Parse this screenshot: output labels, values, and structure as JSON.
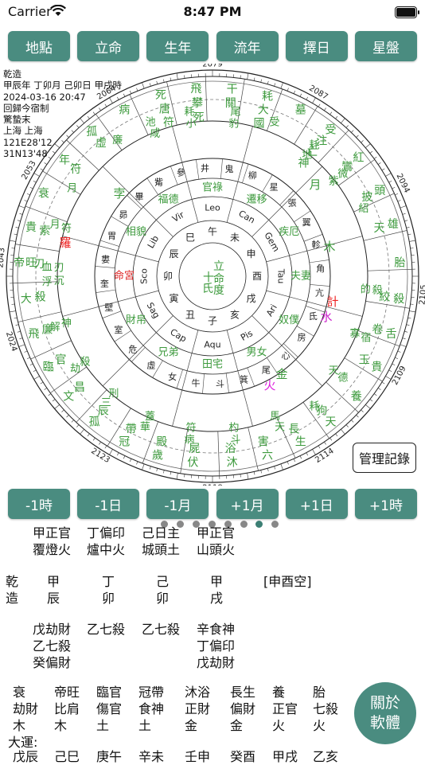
{
  "status_bar": {
    "carrier": "Carrier",
    "time": "8:47 PM"
  },
  "top_buttons": [
    "地點",
    "立命",
    "生年",
    "流年",
    "擇日",
    "星盤"
  ],
  "bottom_buttons": [
    "-1時",
    "-1日",
    "-1月",
    "+1月",
    "+1日",
    "+1時"
  ],
  "records_button": "管理記錄",
  "about_button": [
    "關於",
    "軟體"
  ],
  "chart_info": [
    "乾造",
    "甲辰年 丁卯月 己卯日 甲戌時",
    "2024-03-16 20:47",
    "回歸今宿制",
    "驚蟄末",
    "上海 上海",
    "121E28'12",
    " 31N13'48"
  ],
  "wheel": {
    "year_ticks": [
      "2079",
      "2087",
      "2094",
      "2105",
      "2109",
      "2114",
      "2118",
      "2123",
      "2024",
      "2043",
      "2053",
      "2064"
    ],
    "outer_spokes": [
      {
        "a": -86,
        "words": [
          "帝旺",
          "刃"
        ]
      },
      {
        "a": -75,
        "words": [
          "貴",
          "索"
        ]
      },
      {
        "a": -64,
        "words": [
          "衰"
        ]
      },
      {
        "a": -52,
        "words": [
          "年",
          "符"
        ]
      },
      {
        "a": -40,
        "words": [
          "孤",
          "虛"
        ]
      },
      {
        "a": -28,
        "words": [
          "病"
        ]
      },
      {
        "a": -16,
        "words": [
          "死",
          "唐",
          "符"
        ]
      },
      {
        "a": -5,
        "words": [
          "飛",
          "攀",
          "死"
        ]
      },
      {
        "a": 6,
        "words": [
          "干",
          "關"
        ]
      },
      {
        "a": 17,
        "words": [
          "耗",
          "大",
          "國"
        ]
      },
      {
        "a": 28,
        "words": [
          "墓"
        ]
      },
      {
        "a": 39,
        "words": [
          "受",
          "注",
          "亡",
          "神"
        ]
      },
      {
        "a": 51,
        "words": [
          "紅",
          "鸞"
        ]
      },
      {
        "a": 63,
        "words": [
          "頭",
          "披"
        ]
      },
      {
        "a": 74,
        "words": [
          "雄",
          "天"
        ]
      },
      {
        "a": 86,
        "words": [
          "胎"
        ]
      },
      {
        "a": 97,
        "words": [
          "殺",
          "絞"
        ]
      },
      {
        "a": 108,
        "words": [
          "舌",
          "卷"
        ]
      },
      {
        "a": 119,
        "words": [
          "貴",
          "玉"
        ]
      },
      {
        "a": 130,
        "words": [
          "養"
        ]
      },
      {
        "a": 141,
        "words": [
          "天",
          "狗"
        ]
      },
      {
        "a": 152,
        "words": [
          "生",
          "長"
        ]
      },
      {
        "a": 163,
        "words": [
          "六",
          "害"
        ]
      },
      {
        "a": 174,
        "words": [
          "沐",
          "浴"
        ]
      },
      {
        "a": 186,
        "words": [
          "伏",
          "屍"
        ]
      },
      {
        "a": 197,
        "words": [
          "歲",
          "殿"
        ]
      },
      {
        "a": 208,
        "words": [
          "冠",
          "帶"
        ]
      },
      {
        "a": 219,
        "words": [
          "孤",
          "辰"
        ]
      },
      {
        "a": 230,
        "words": [
          "文",
          "昌"
        ]
      },
      {
        "a": 241,
        "words": [
          "臨",
          "官"
        ]
      },
      {
        "a": 252,
        "words": [
          "飛",
          "廉"
        ]
      },
      {
        "a": 263,
        "words": [
          "大",
          "殺"
        ]
      }
    ],
    "inner_spokes": [
      {
        "a": -87,
        "words": [
          "血",
          "刃"
        ]
      },
      {
        "a": -72,
        "words": [
          "月",
          "符"
        ]
      },
      {
        "a": -58,
        "words": [
          "月"
        ]
      },
      {
        "a": -35,
        "words": [
          "廉"
        ]
      },
      {
        "a": -22,
        "words": [
          "池",
          "咸"
        ]
      },
      {
        "a": -8,
        "words": [
          "耗",
          "小"
        ]
      },
      {
        "a": 8,
        "words": [
          "尾",
          "豹"
        ]
      },
      {
        "a": 22,
        "words": [
          "受"
        ]
      },
      {
        "a": 38,
        "words": [
          "耗",
          "地"
        ]
      },
      {
        "a": 52,
        "words": [
          "微",
          "紫"
        ]
      },
      {
        "a": 66,
        "words": [
          "紹"
        ]
      },
      {
        "a": 95,
        "words": [
          "殺",
          "的"
        ]
      },
      {
        "a": 112,
        "words": [
          "宿",
          "寡"
        ]
      },
      {
        "a": 128,
        "words": [
          "德",
          "天"
        ]
      },
      {
        "a": 142,
        "words": [
          "耗"
        ]
      },
      {
        "a": 156,
        "words": [
          "天",
          "馬"
        ]
      },
      {
        "a": 172,
        "words": [
          "斗",
          "杓"
        ]
      },
      {
        "a": 188,
        "words": [
          "病",
          "符"
        ]
      },
      {
        "a": 204,
        "words": [
          "華",
          "蓋"
        ]
      },
      {
        "a": 220,
        "words": [
          "三",
          "刑"
        ]
      },
      {
        "a": 236,
        "words": [
          "劫",
          "殺"
        ]
      },
      {
        "a": 252,
        "words": [
          "解",
          "神"
        ]
      },
      {
        "a": 268,
        "words": [
          "浮",
          "沉"
        ]
      }
    ],
    "mansions": [
      "井",
      "鬼",
      "柳",
      "星",
      "張",
      "翼",
      "軫",
      "角",
      "亢",
      "氐",
      "房",
      "心",
      "尾",
      "箕",
      "斗",
      "牛",
      "女",
      "虛",
      "危",
      "室",
      "壁",
      "奎",
      "婁",
      "胃",
      "昴",
      "畢",
      "觜",
      "參"
    ],
    "palaces": [
      "官祿",
      "遷移",
      "疾厄",
      "夫妻",
      "奴僕",
      "男女",
      "田宅",
      "兄弟",
      "財帛",
      "命宮",
      "相貌",
      "福德"
    ],
    "signs": [
      "Leo",
      "Can",
      "Gem",
      "Tau",
      "Ari",
      "Pis",
      "Aqu",
      "Cap",
      "Sag",
      "Sco",
      "Lib",
      "Vir"
    ],
    "branches": [
      "午",
      "未",
      "申",
      "酉",
      "戌",
      "亥",
      "子",
      "丑",
      "寅",
      "卯",
      "辰",
      "巳"
    ],
    "planets": [
      "計",
      "水",
      "金",
      "火",
      "木",
      "羅",
      "月",
      "孛"
    ],
    "center": [
      "立",
      "命",
      "度",
      "十",
      "氏"
    ]
  },
  "pillars": {
    "hidden_top": [
      [
        "甲正官",
        "覆燈火"
      ],
      [
        "丁偏印",
        "爐中火"
      ],
      [
        "己日主",
        "城頭土"
      ],
      [
        "甲正官",
        "山頭火"
      ]
    ],
    "gender": [
      "乾",
      "造"
    ],
    "stems": [
      "甲",
      "丁",
      "己",
      "甲"
    ],
    "branches": [
      "辰",
      "卯",
      "卯",
      "戌"
    ],
    "void": "[申酉空]",
    "hidden_stems": [
      [
        "戊劫財",
        "乙七殺",
        "癸偏財"
      ],
      [
        "乙七殺"
      ],
      [
        "乙七殺"
      ],
      [
        "辛食神",
        "丁偏印",
        "戊劫財"
      ]
    ],
    "stages": [
      "衰",
      "帝旺",
      "臨官",
      "冠帶",
      "沐浴",
      "長生",
      "養",
      "胎"
    ],
    "ten_gods": [
      "劫財",
      "比肩",
      "傷官",
      "食神",
      "正財",
      "偏財",
      "正官",
      "七殺"
    ],
    "elements": [
      "木",
      "木",
      "土",
      "土",
      "金",
      "金",
      "火",
      "火"
    ],
    "dayun_label": "大運:",
    "dayun": [
      "戊辰",
      "己巳",
      "庚午",
      "辛未",
      "壬申",
      "癸酉",
      "甲戌",
      "乙亥"
    ]
  }
}
